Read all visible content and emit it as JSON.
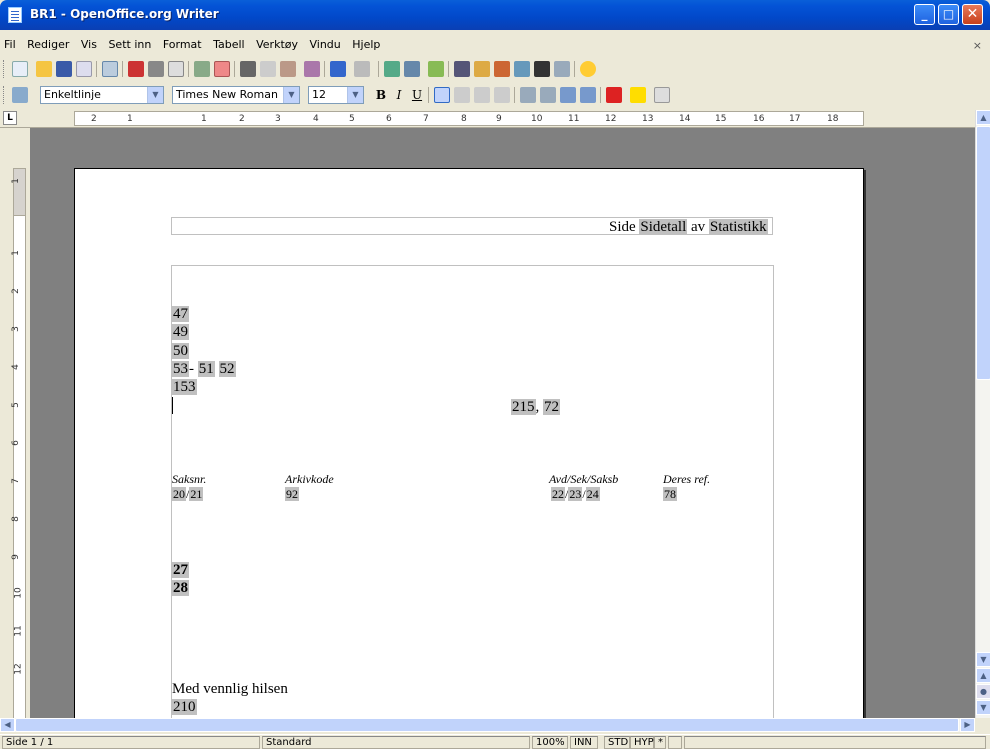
{
  "window": {
    "title": "BR1 - OpenOffice.org Writer",
    "min_label": "_",
    "max_label": "□",
    "close_label": "✕"
  },
  "menu": [
    "Fil",
    "Rediger",
    "Vis",
    "Sett inn",
    "Format",
    "Tabell",
    "Verktøy",
    "Vindu",
    "Hjelp"
  ],
  "menu_close": "×",
  "format_toolbar": {
    "style": "Enkeltlinje",
    "font": "Times New Roman",
    "size": "12",
    "bold": "B",
    "italic": "I",
    "underline": "U"
  },
  "ruler": {
    "corner": "L",
    "h_ticks": [
      "2",
      "1",
      "1",
      "2",
      "3",
      "4",
      "5",
      "6",
      "7",
      "8",
      "9",
      "10",
      "11",
      "12",
      "13",
      "14",
      "15",
      "16",
      "17",
      "18"
    ],
    "v_ticks": [
      "1",
      "1",
      "2",
      "3",
      "4",
      "5",
      "6",
      "7",
      "8",
      "9",
      "10",
      "11",
      "12"
    ]
  },
  "document": {
    "header": {
      "side": "Side",
      "sidetall": "Sidetall",
      "av": "av",
      "statistikk": "Statistikk"
    },
    "fields": {
      "f47": "47",
      "f49": "49",
      "f50": "50",
      "f53": "53",
      "dash": "-",
      "f51": "51",
      "f52": "52",
      "f153": "153",
      "f215": "215",
      "comma": ",",
      "f72": "72"
    },
    "labels": {
      "saksnr": "Saksnr.",
      "arkivkode": "Arkivkode",
      "avd": "Avd/Sek/Saksb",
      "deres_ref": "Deres ref."
    },
    "values": {
      "v20": "20",
      "slash": "/",
      "v21": "21",
      "v92": "92",
      "v22": "22",
      "v23": "23",
      "v24": "24",
      "v78": "78"
    },
    "bold_fields": {
      "b27": "27",
      "b28": "28"
    },
    "closing": "Med vennlig hilsen",
    "sign_field": "210"
  },
  "status": {
    "page": "Side 1 / 1",
    "style": "Standard",
    "zoom": "100%",
    "ins": "INN",
    "std": "STD",
    "hyp": "HYP",
    "modified": "*"
  }
}
